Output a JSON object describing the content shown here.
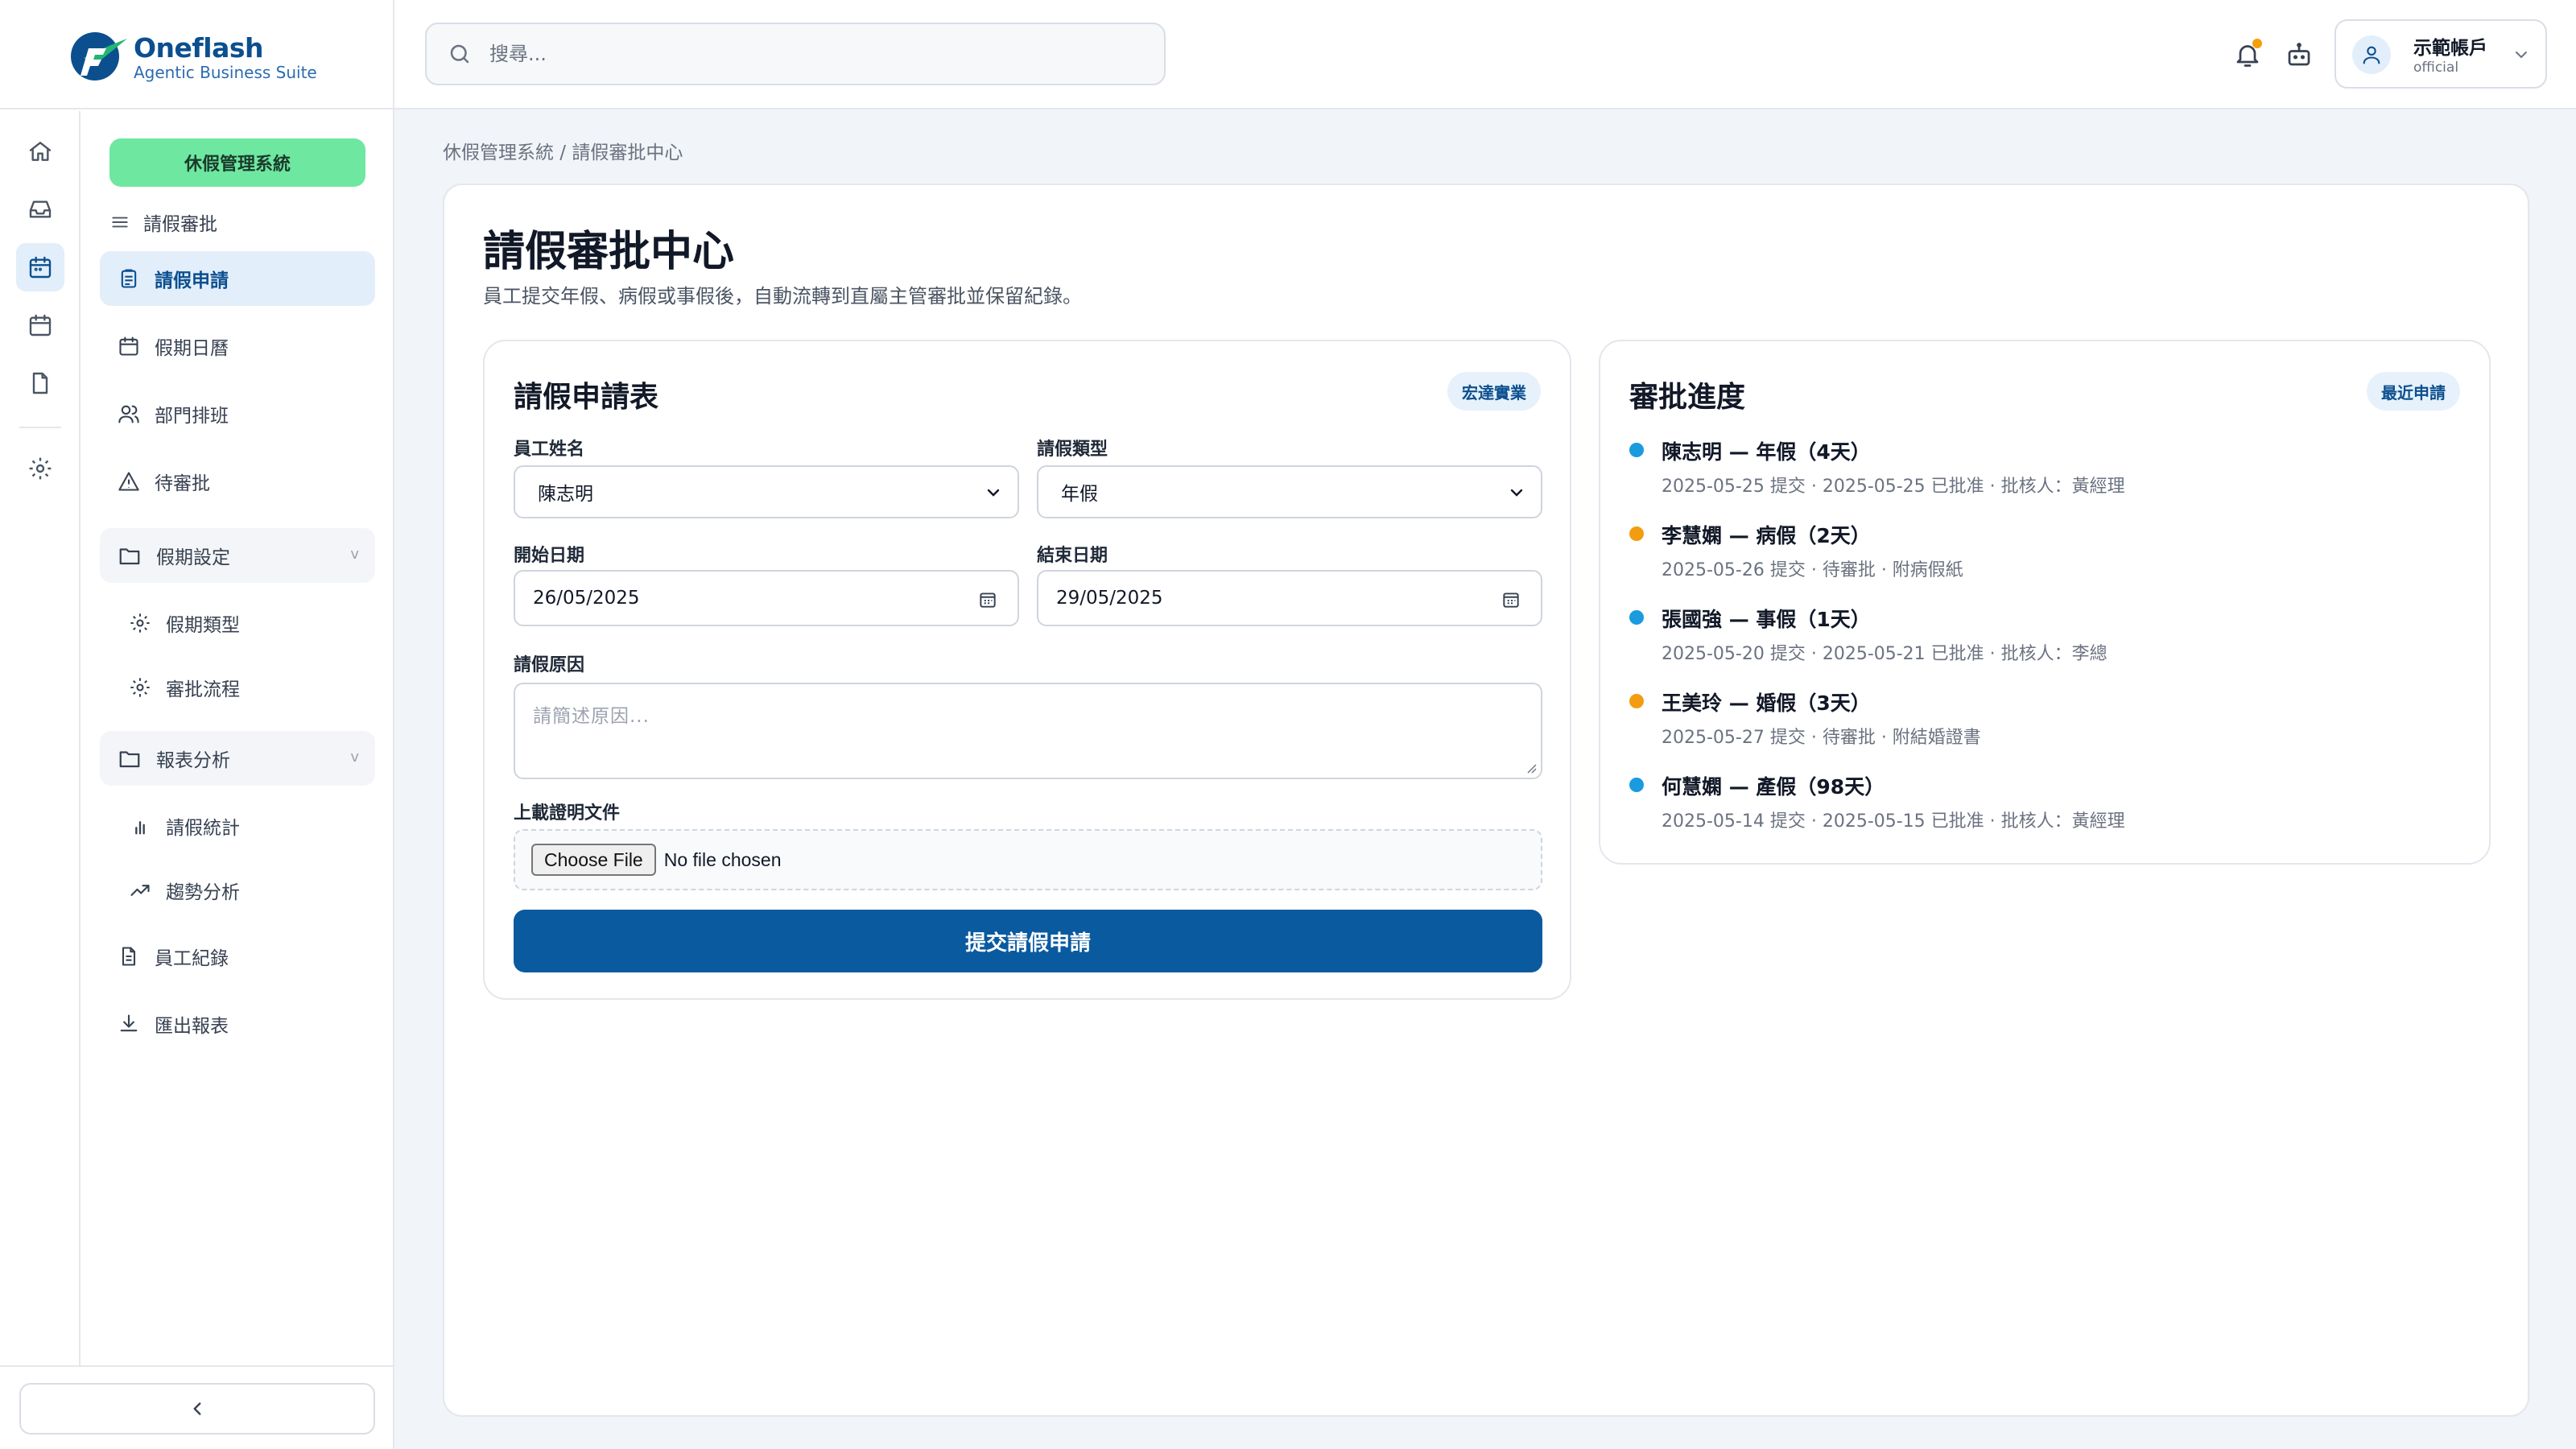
{
  "app": {
    "brand": "Oneflash",
    "tagline": "Agentic Business Suite"
  },
  "header": {
    "search_placeholder": "搜尋...",
    "account": {
      "name": "示範帳戶",
      "role": "official"
    }
  },
  "sidebar": {
    "system_badge": "休假管理系統",
    "section_label": "請假審批",
    "items": [
      {
        "label": "請假申請"
      },
      {
        "label": "假期日曆"
      },
      {
        "label": "部門排班"
      },
      {
        "label": "待審批"
      },
      {
        "label": "假期設定"
      },
      {
        "label": "假期類型"
      },
      {
        "label": "審批流程"
      },
      {
        "label": "報表分析"
      },
      {
        "label": "請假統計"
      },
      {
        "label": "趨勢分析"
      },
      {
        "label": "員工紀錄"
      },
      {
        "label": "匯出報表"
      }
    ],
    "group_chevron": "v"
  },
  "breadcrumb": "休假管理系統 / 請假審批中心",
  "page": {
    "title": "請假審批中心",
    "description": "員工提交年假、病假或事假後，自動流轉到直屬主管審批並保留紀錄。"
  },
  "form": {
    "title": "請假申請表",
    "company_tag": "宏達實業",
    "employee_label": "員工姓名",
    "employee_value": "陳志明",
    "type_label": "請假類型",
    "type_value": "年假",
    "start_label": "開始日期",
    "start_value": "26/05/2025",
    "end_label": "結束日期",
    "end_value": "29/05/2025",
    "reason_label": "請假原因",
    "reason_placeholder": "請簡述原因...",
    "upload_label": "上載證明文件",
    "file_button": "Choose File",
    "file_status": "No file chosen",
    "submit_label": "提交請假申請"
  },
  "progress": {
    "title": "審批進度",
    "tag": "最近申請",
    "colors": {
      "approved": "#1a9be0",
      "pending": "#f39c12"
    },
    "items": [
      {
        "title": "陳志明 — 年假（4天）",
        "meta": "2025-05-25 提交 · 2025-05-25 已批准 · 批核人：黃經理",
        "status": "approved"
      },
      {
        "title": "李慧嫻 — 病假（2天）",
        "meta": "2025-05-26 提交 · 待審批 · 附病假紙",
        "status": "pending"
      },
      {
        "title": "張國強 — 事假（1天）",
        "meta": "2025-05-20 提交 · 2025-05-21 已批准 · 批核人：李總",
        "status": "approved"
      },
      {
        "title": "王美玲 — 婚假（3天）",
        "meta": "2025-05-27 提交 · 待審批 · 附結婚證書",
        "status": "pending"
      },
      {
        "title": "何慧嫻 — 產假（98天）",
        "meta": "2025-05-14 提交 · 2025-05-15 已批准 · 批核人：黃經理",
        "status": "approved"
      }
    ]
  }
}
